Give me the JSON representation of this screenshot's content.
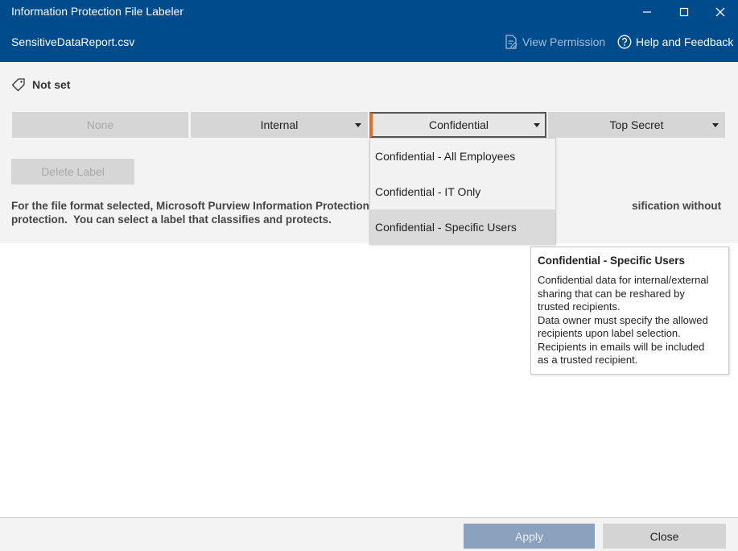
{
  "window": {
    "title": "Information Protection File Labeler",
    "file_name": "SensitiveDataReport.csv",
    "controls": {
      "minimize": "minimize-icon",
      "maximize": "maximize-icon",
      "close": "close-icon"
    }
  },
  "header": {
    "view_permission_label": "View Permission",
    "help_feedback_label": "Help and Feedback"
  },
  "current_label": {
    "icon": "tag-icon",
    "text": "Not set"
  },
  "labels": {
    "none": "None",
    "internal": "Internal",
    "confidential": "Confidential",
    "top_secret": "Top Secret"
  },
  "delete_label_button": "Delete Label",
  "info_text": "For the file format selected, Microsoft Purview Information Protection can classify and protect. You can select a label that applies classification without protection.  You can select a label that classifies and protects.",
  "info_text_visible": "For the file format selected, Microsoft Purview Information Protection c                                                                                    sification without protection.  You can select a label that classifies and protects.",
  "dropdown": {
    "items": [
      "Confidential - All Employees",
      "Confidential - IT Only",
      "Confidential - Specific Users"
    ],
    "highlighted_index": 2
  },
  "tooltip": {
    "title": "Confidential - Specific Users",
    "body_lines": [
      "Confidential data for internal/external",
      "sharing that can be reshared by",
      "trusted recipients.",
      "Data owner must specify the allowed",
      "recipients upon label selection.",
      "Recipients in emails will be included",
      "as a trusted recipient."
    ]
  },
  "footer": {
    "apply_label": "Apply",
    "close_label": "Close"
  },
  "colors": {
    "titlebar": "#004b8c",
    "accent_selected": "#e07020",
    "apply_disabled": "#8aa2bd"
  }
}
